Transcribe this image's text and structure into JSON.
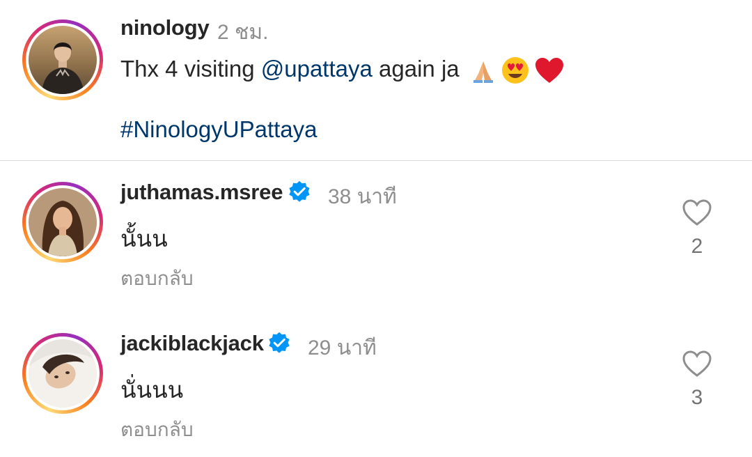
{
  "post": {
    "username": "ninology",
    "time": "2 ชม.",
    "text_before": "Thx 4 visiting ",
    "mention": "@upattaya",
    "text_after": " again ja",
    "emojis": [
      "folded-hands-emoji",
      "heart-eyes-emoji",
      "red-heart-emoji"
    ],
    "hashtag": "#NinologyUPattaya"
  },
  "comments": [
    {
      "username": "juthamas.msree",
      "verified": true,
      "time": "38 นาที",
      "text": "นั้นน",
      "reply_label": "ตอบกลับ",
      "likes": "2"
    },
    {
      "username": "jackiblackjack",
      "verified": true,
      "time": "29 นาที",
      "text": "นั่นนน",
      "reply_label": "ตอบกลับ",
      "likes": "3"
    }
  ],
  "colors": {
    "link": "#00376b",
    "verified": "#0095f6",
    "muted": "#8e8e8e",
    "text": "#262626"
  }
}
